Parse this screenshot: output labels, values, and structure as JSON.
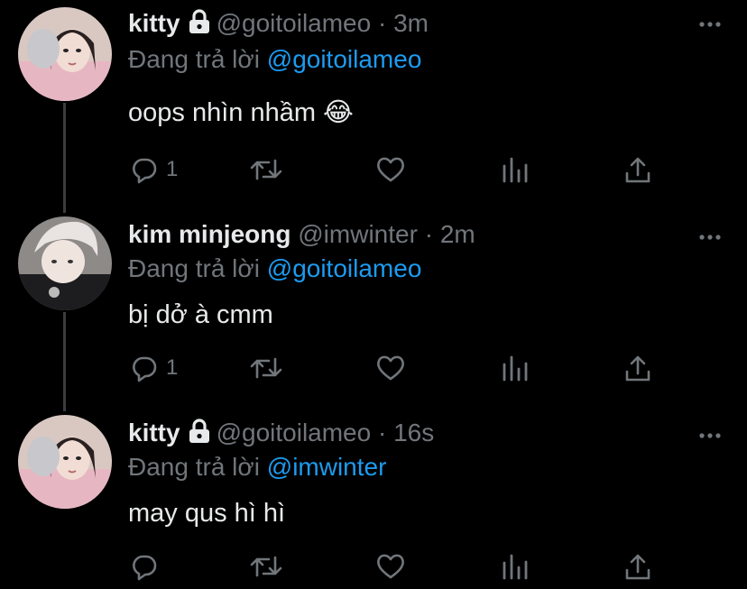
{
  "tweets": [
    {
      "name": "kitty",
      "locked": true,
      "handle": "@goitoilameo",
      "sep": "·",
      "time": "3m",
      "reply_prefix": "Đang trả lời",
      "reply_to": "@goitoilameo",
      "text": "oops nhìn nhầm 😂",
      "reply_count": "1"
    },
    {
      "name": "kim minjeong",
      "locked": false,
      "handle": "@imwinter",
      "sep": "·",
      "time": "2m",
      "reply_prefix": "Đang trả lời",
      "reply_to": "@goitoilameo",
      "text": "bị dở à cmm",
      "reply_count": "1"
    },
    {
      "name": "kitty",
      "locked": true,
      "handle": "@goitoilameo",
      "sep": "·",
      "time": "16s",
      "reply_prefix": "Đang trả lời",
      "reply_to": "@imwinter",
      "text": "may qus hì hì",
      "reply_count": ""
    }
  ],
  "colors": {
    "background": "#000000",
    "text": "#e7e9ea",
    "muted": "#71767b",
    "link": "#1d9bf0"
  },
  "icons": [
    "lock-icon",
    "more-icon",
    "reply-icon",
    "retweet-icon",
    "like-icon",
    "analytics-icon",
    "share-icon"
  ]
}
